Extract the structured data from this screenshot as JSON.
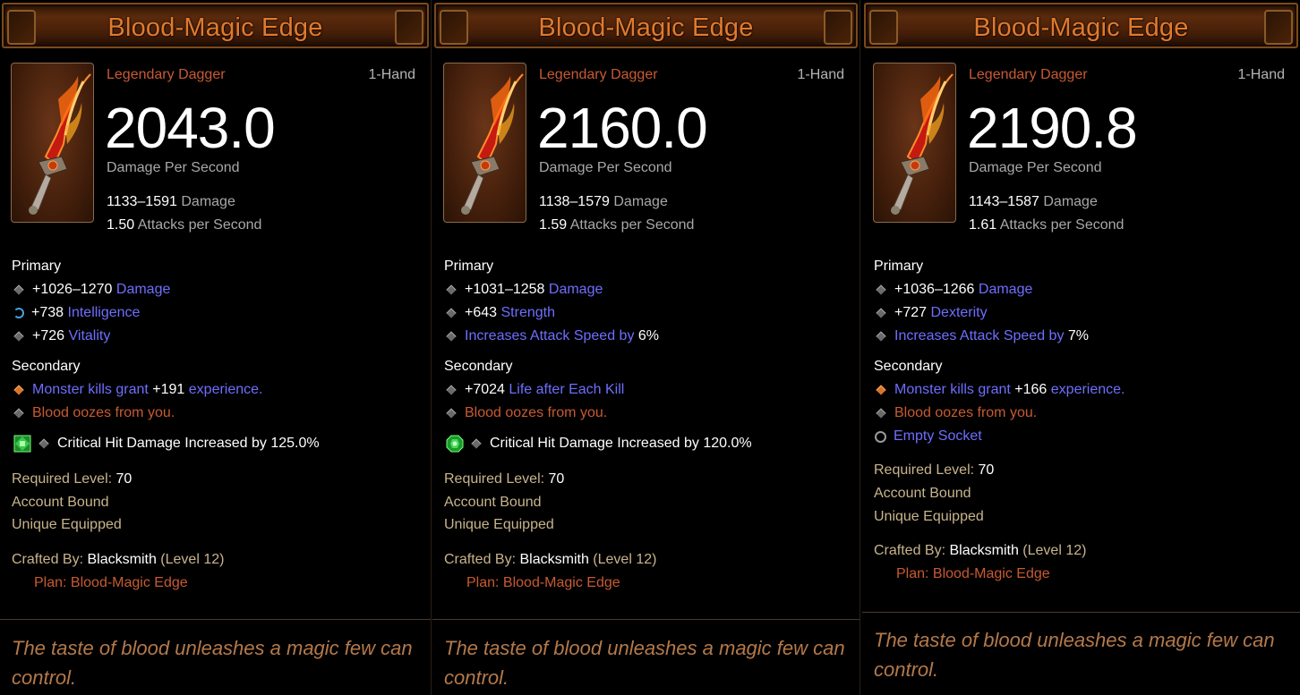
{
  "cards": [
    {
      "title": "Blood-Magic Edge",
      "type": "Legendary Dagger",
      "hand": "1-Hand",
      "dps": "2043.0",
      "dps_label": "Damage Per Second",
      "damage_range": "1133–1591",
      "damage_label": "Damage",
      "aps": "1.50",
      "aps_label": "Attacks per Second",
      "primary_label": "Primary",
      "primary": [
        {
          "icon": "diamond-icon",
          "value": "+1026–1270",
          "stat": "Damage"
        },
        {
          "icon": "swirl-icon",
          "value": "+738",
          "stat": "Intelligence"
        },
        {
          "icon": "diamond-icon",
          "value": "+726",
          "stat": "Vitality"
        }
      ],
      "secondary_label": "Secondary",
      "secondary": [
        {
          "icon": "orange-diamond-icon",
          "pre": "Monster kills grant",
          "value": "+191",
          "post": "experience."
        },
        {
          "icon": "diamond-icon",
          "text": "Blood oozes from you."
        }
      ],
      "gem_line": "Critical Hit Damage Increased by 125.0%",
      "gem_icon": "emerald-square-gem-icon",
      "required_label": "Required Level:",
      "required_level": "70",
      "bound": "Account Bound",
      "unique": "Unique Equipped",
      "crafted_label": "Crafted By:",
      "crafter": "Blacksmith",
      "crafter_level": "(Level 12)",
      "plan": "Plan: Blood-Magic Edge",
      "flavor": "The taste of blood unleashes a magic few can control."
    },
    {
      "title": "Blood-Magic Edge",
      "type": "Legendary Dagger",
      "hand": "1-Hand",
      "dps": "2160.0",
      "dps_label": "Damage Per Second",
      "damage_range": "1138–1579",
      "damage_label": "Damage",
      "aps": "1.59",
      "aps_label": "Attacks per Second",
      "primary_label": "Primary",
      "primary": [
        {
          "icon": "diamond-icon",
          "value": "+1031–1258",
          "stat": "Damage"
        },
        {
          "icon": "diamond-icon",
          "value": "+643",
          "stat": "Strength"
        },
        {
          "icon": "diamond-icon",
          "stat": "Increases Attack Speed by",
          "value": "6%"
        }
      ],
      "secondary_label": "Secondary",
      "secondary": [
        {
          "icon": "diamond-icon",
          "value": "+7024",
          "post": "Life after Each Kill"
        },
        {
          "icon": "diamond-icon",
          "text": "Blood oozes from you."
        }
      ],
      "gem_line": "Critical Hit Damage Increased by 120.0%",
      "gem_icon": "emerald-round-gem-icon",
      "required_label": "Required Level:",
      "required_level": "70",
      "bound": "Account Bound",
      "unique": "Unique Equipped",
      "crafted_label": "Crafted By:",
      "crafter": "Blacksmith",
      "crafter_level": "(Level 12)",
      "plan": "Plan: Blood-Magic Edge",
      "flavor": "The taste of blood unleashes a magic few can control."
    },
    {
      "title": "Blood-Magic Edge",
      "type": "Legendary Dagger",
      "hand": "1-Hand",
      "dps": "2190.8",
      "dps_label": "Damage Per Second",
      "damage_range": "1143–1587",
      "damage_label": "Damage",
      "aps": "1.61",
      "aps_label": "Attacks per Second",
      "primary_label": "Primary",
      "primary": [
        {
          "icon": "diamond-icon",
          "value": "+1036–1266",
          "stat": "Damage"
        },
        {
          "icon": "diamond-icon",
          "value": "+727",
          "stat": "Dexterity"
        },
        {
          "icon": "diamond-icon",
          "stat": "Increases Attack Speed by",
          "value": "7%"
        }
      ],
      "secondary_label": "Secondary",
      "secondary": [
        {
          "icon": "orange-diamond-icon",
          "pre": "Monster kills grant",
          "value": "+166",
          "post": "experience."
        },
        {
          "icon": "diamond-icon",
          "text": "Blood oozes from you."
        }
      ],
      "socket": "Empty Socket",
      "required_label": "Required Level:",
      "required_level": "70",
      "bound": "Account Bound",
      "unique": "Unique Equipped",
      "crafted_label": "Crafted By:",
      "crafter": "Blacksmith",
      "crafter_level": "(Level 12)",
      "plan": "Plan: Blood-Magic Edge",
      "flavor": "The taste of blood unleashes a magic few can control."
    }
  ]
}
